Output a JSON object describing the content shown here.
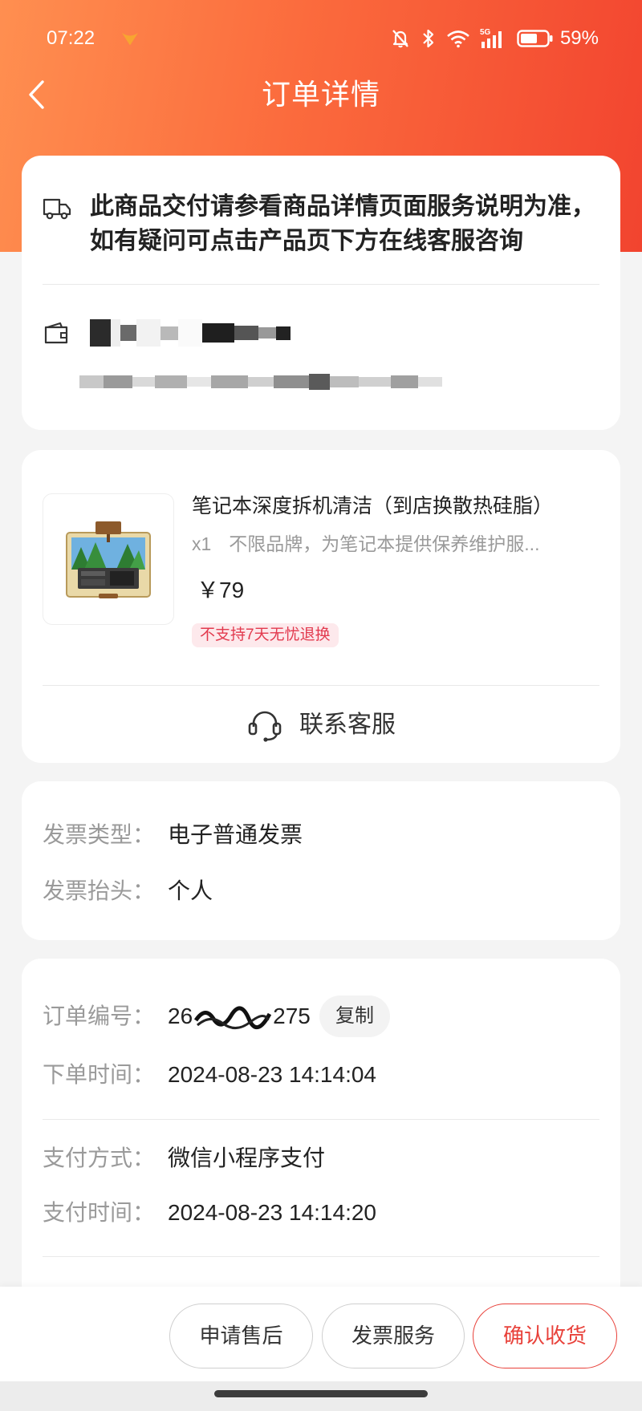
{
  "status_bar": {
    "time": "07:22",
    "network": "5G",
    "battery": "59%",
    "icons": [
      "notification-icon",
      "mute-icon",
      "bluetooth-icon",
      "wifi-icon",
      "cellular-signal-icon",
      "battery-icon"
    ]
  },
  "header": {
    "title": "订单详情",
    "back_icon": "chevron-left-icon"
  },
  "notice": {
    "icon": "truck-icon",
    "line1": "此商品交付请参看商品详情页面服务说明为准，",
    "line2": "如有疑问可点击产品页下方在线客服咨询"
  },
  "address": {
    "icon": "wallet-icon"
  },
  "product": {
    "title": "笔记本深度拆机清洁（到店换散热硅脂）",
    "quantity": "x1",
    "desc": "不限品牌，为笔记本提供保养维护服...",
    "price": "￥79",
    "badge": "不支持7天无忧退换"
  },
  "contact": {
    "icon": "headset-icon",
    "label": "联系客服"
  },
  "invoice": {
    "rows": [
      {
        "label": "发票类型：",
        "value": "电子普通发票"
      },
      {
        "label": "发票抬头：",
        "value": "个人"
      }
    ]
  },
  "order": {
    "number_label": "订单编号：",
    "number_prefix": "26",
    "number_suffix": "275",
    "copy_label": "复制",
    "created_label": "下单时间：",
    "created_value": "2024-08-23 14:14:04",
    "pay_method_label": "支付方式：",
    "pay_method_value": "微信小程序支付",
    "pay_time_label": "支付时间：",
    "pay_time_value": "2024-08-23 14:14:20"
  },
  "actions": {
    "after_sale": "申请售后",
    "invoice_service": "发票服务",
    "confirm": "确认收货"
  },
  "colors": {
    "header_start": "#ff8f50",
    "header_end": "#f2442f",
    "accent": "#e8413a",
    "badge_bg": "#fde9ec",
    "badge_text": "#e23a4e",
    "page_bg": "#f4f4f4"
  }
}
